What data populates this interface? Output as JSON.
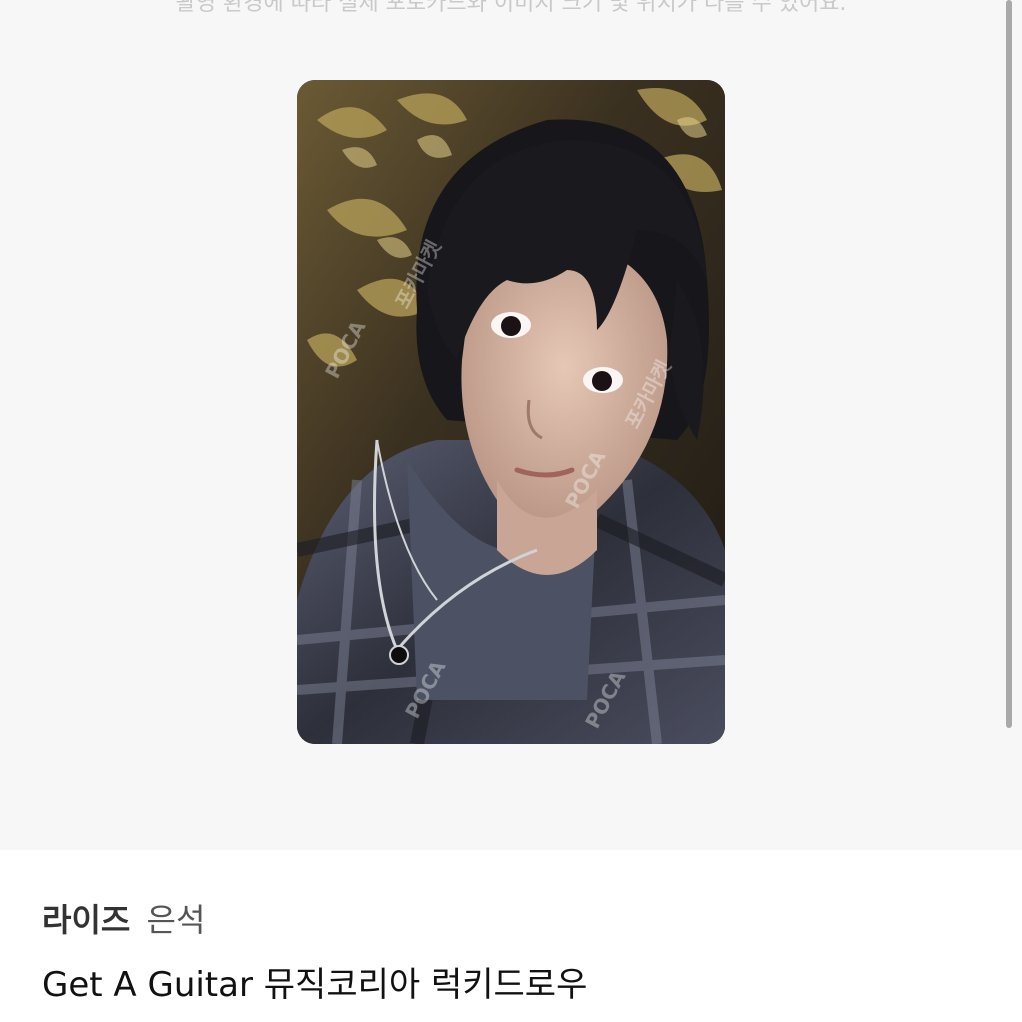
{
  "notice_text": "촬영 환경에 따라 실제 포토카드와 이미지 크기 및 위치가 다를 수 있어요.",
  "product": {
    "group": "라이즈",
    "member": "은석",
    "album": "Get A Guitar 뮤직코리아 럭키드로우"
  },
  "watermark": {
    "brand": "POCA",
    "label": "포카마켓"
  },
  "colors": {
    "photo_background": "#f7f7f7",
    "notice_text": "#c9c9c9",
    "title_text": "#111111"
  }
}
